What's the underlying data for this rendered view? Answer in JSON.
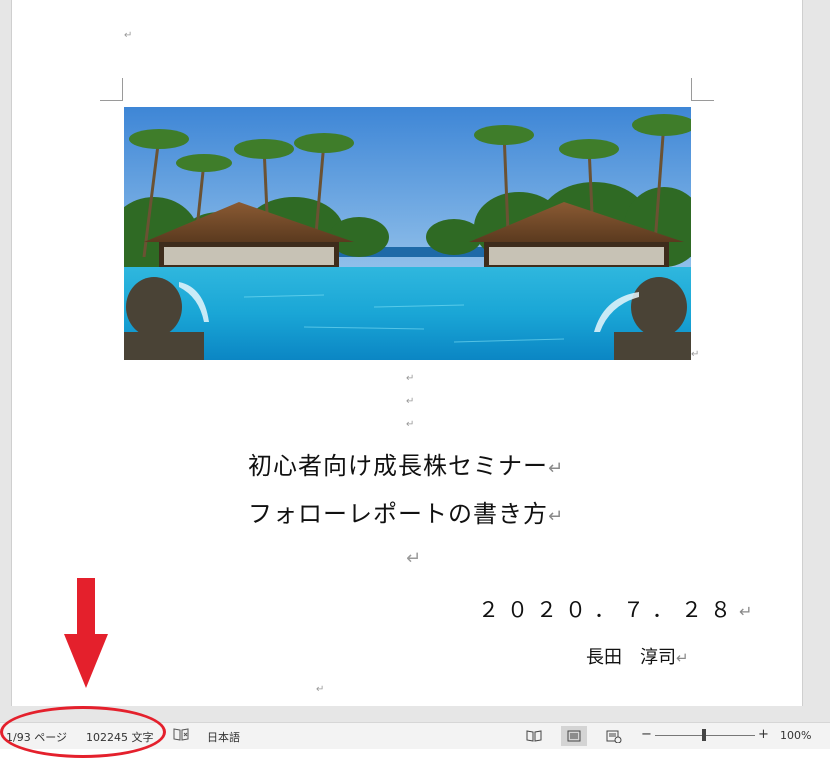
{
  "document": {
    "title_line1": "初心者向け成長株セミナー",
    "title_line2": "フォローレポートの書き方",
    "date": "２０２０．７．２８",
    "author": "長田　淳司",
    "paragraph_mark": "↵"
  },
  "statusbar": {
    "page_info": "1/93 ページ",
    "word_count": "102245 文字",
    "proofing_icon": "proofing-book-icon",
    "language": "日本語",
    "zoom_minus": "−",
    "zoom_plus": "+",
    "zoom_level": "100%"
  },
  "colors": {
    "annotation_red": "#e4202c",
    "workspace_bg": "#e6e6e6",
    "statusbar_bg": "#f3f3f3"
  }
}
